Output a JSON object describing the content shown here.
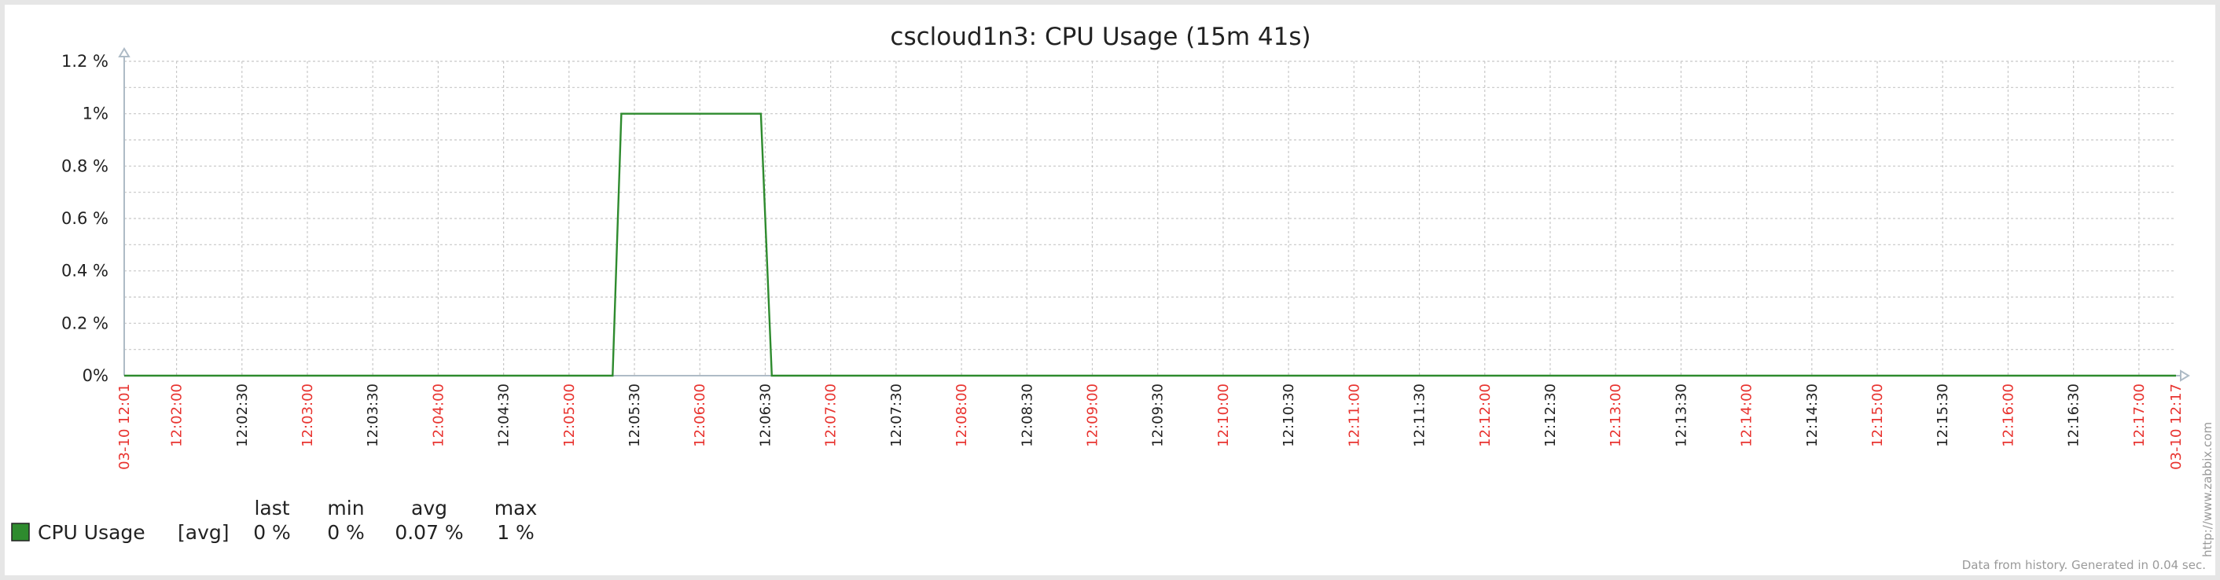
{
  "chart_data": {
    "type": "line",
    "title": "cscloud1n3: CPU Usage (15m 41s)",
    "y_tick_labels": [
      "0%",
      "0.2 %",
      "0.4 %",
      "0.6 %",
      "0.8 %",
      "1%",
      "1.2 %"
    ],
    "y_tick_values": [
      0,
      0.2,
      0.4,
      0.6,
      0.8,
      1.0,
      1.2
    ],
    "ylim": [
      0,
      1.2
    ],
    "x_range": [
      "12:01:36",
      "12:17:17"
    ],
    "x_tick_labels": [
      {
        "label": "03-10 12:01",
        "time": "12:01:36",
        "major": true
      },
      {
        "label": "12:02:00",
        "time": "12:02:00",
        "major": true
      },
      {
        "label": "12:02:30",
        "time": "12:02:30",
        "major": false
      },
      {
        "label": "12:03:00",
        "time": "12:03:00",
        "major": true
      },
      {
        "label": "12:03:30",
        "time": "12:03:30",
        "major": false
      },
      {
        "label": "12:04:00",
        "time": "12:04:00",
        "major": true
      },
      {
        "label": "12:04:30",
        "time": "12:04:30",
        "major": false
      },
      {
        "label": "12:05:00",
        "time": "12:05:00",
        "major": true
      },
      {
        "label": "12:05:30",
        "time": "12:05:30",
        "major": false
      },
      {
        "label": "12:06:00",
        "time": "12:06:00",
        "major": true
      },
      {
        "label": "12:06:30",
        "time": "12:06:30",
        "major": false
      },
      {
        "label": "12:07:00",
        "time": "12:07:00",
        "major": true
      },
      {
        "label": "12:07:30",
        "time": "12:07:30",
        "major": false
      },
      {
        "label": "12:08:00",
        "time": "12:08:00",
        "major": true
      },
      {
        "label": "12:08:30",
        "time": "12:08:30",
        "major": false
      },
      {
        "label": "12:09:00",
        "time": "12:09:00",
        "major": true
      },
      {
        "label": "12:09:30",
        "time": "12:09:30",
        "major": false
      },
      {
        "label": "12:10:00",
        "time": "12:10:00",
        "major": true
      },
      {
        "label": "12:10:30",
        "time": "12:10:30",
        "major": false
      },
      {
        "label": "12:11:00",
        "time": "12:11:00",
        "major": true
      },
      {
        "label": "12:11:30",
        "time": "12:11:30",
        "major": false
      },
      {
        "label": "12:12:00",
        "time": "12:12:00",
        "major": true
      },
      {
        "label": "12:12:30",
        "time": "12:12:30",
        "major": false
      },
      {
        "label": "12:13:00",
        "time": "12:13:00",
        "major": true
      },
      {
        "label": "12:13:30",
        "time": "12:13:30",
        "major": false
      },
      {
        "label": "12:14:00",
        "time": "12:14:00",
        "major": true
      },
      {
        "label": "12:14:30",
        "time": "12:14:30",
        "major": false
      },
      {
        "label": "12:15:00",
        "time": "12:15:00",
        "major": true
      },
      {
        "label": "12:15:30",
        "time": "12:15:30",
        "major": false
      },
      {
        "label": "12:16:00",
        "time": "12:16:00",
        "major": true
      },
      {
        "label": "12:16:30",
        "time": "12:16:30",
        "major": false
      },
      {
        "label": "12:17:00",
        "time": "12:17:00",
        "major": true
      },
      {
        "label": "03-10 12:17",
        "time": "12:17:17",
        "major": true
      }
    ],
    "grid": true,
    "series": [
      {
        "name": "CPU Usage",
        "color": "#2e8b2e",
        "x": [
          "12:01:36",
          "12:05:20",
          "12:05:24",
          "12:06:28",
          "12:06:33",
          "12:17:17"
        ],
        "y": [
          0,
          0,
          1,
          1,
          0,
          0
        ]
      }
    ]
  },
  "legend": {
    "headers": {
      "last": "last",
      "min": "min",
      "avg": "avg",
      "max": "max"
    },
    "items": [
      {
        "name": "CPU Usage",
        "func": "[avg]",
        "last": "0 %",
        "min": "0 %",
        "avg": "0.07 %",
        "max": "1 %",
        "color": "#2e8b2e"
      }
    ]
  },
  "watermark": "http://www.zabbix.com",
  "footer": "Data from history. Generated in 0.04 sec.",
  "colors": {
    "major_tick": "#e8332f",
    "minor_tick": "#222222",
    "grid": "#c8c8c8",
    "axis": "#aebbc6"
  }
}
